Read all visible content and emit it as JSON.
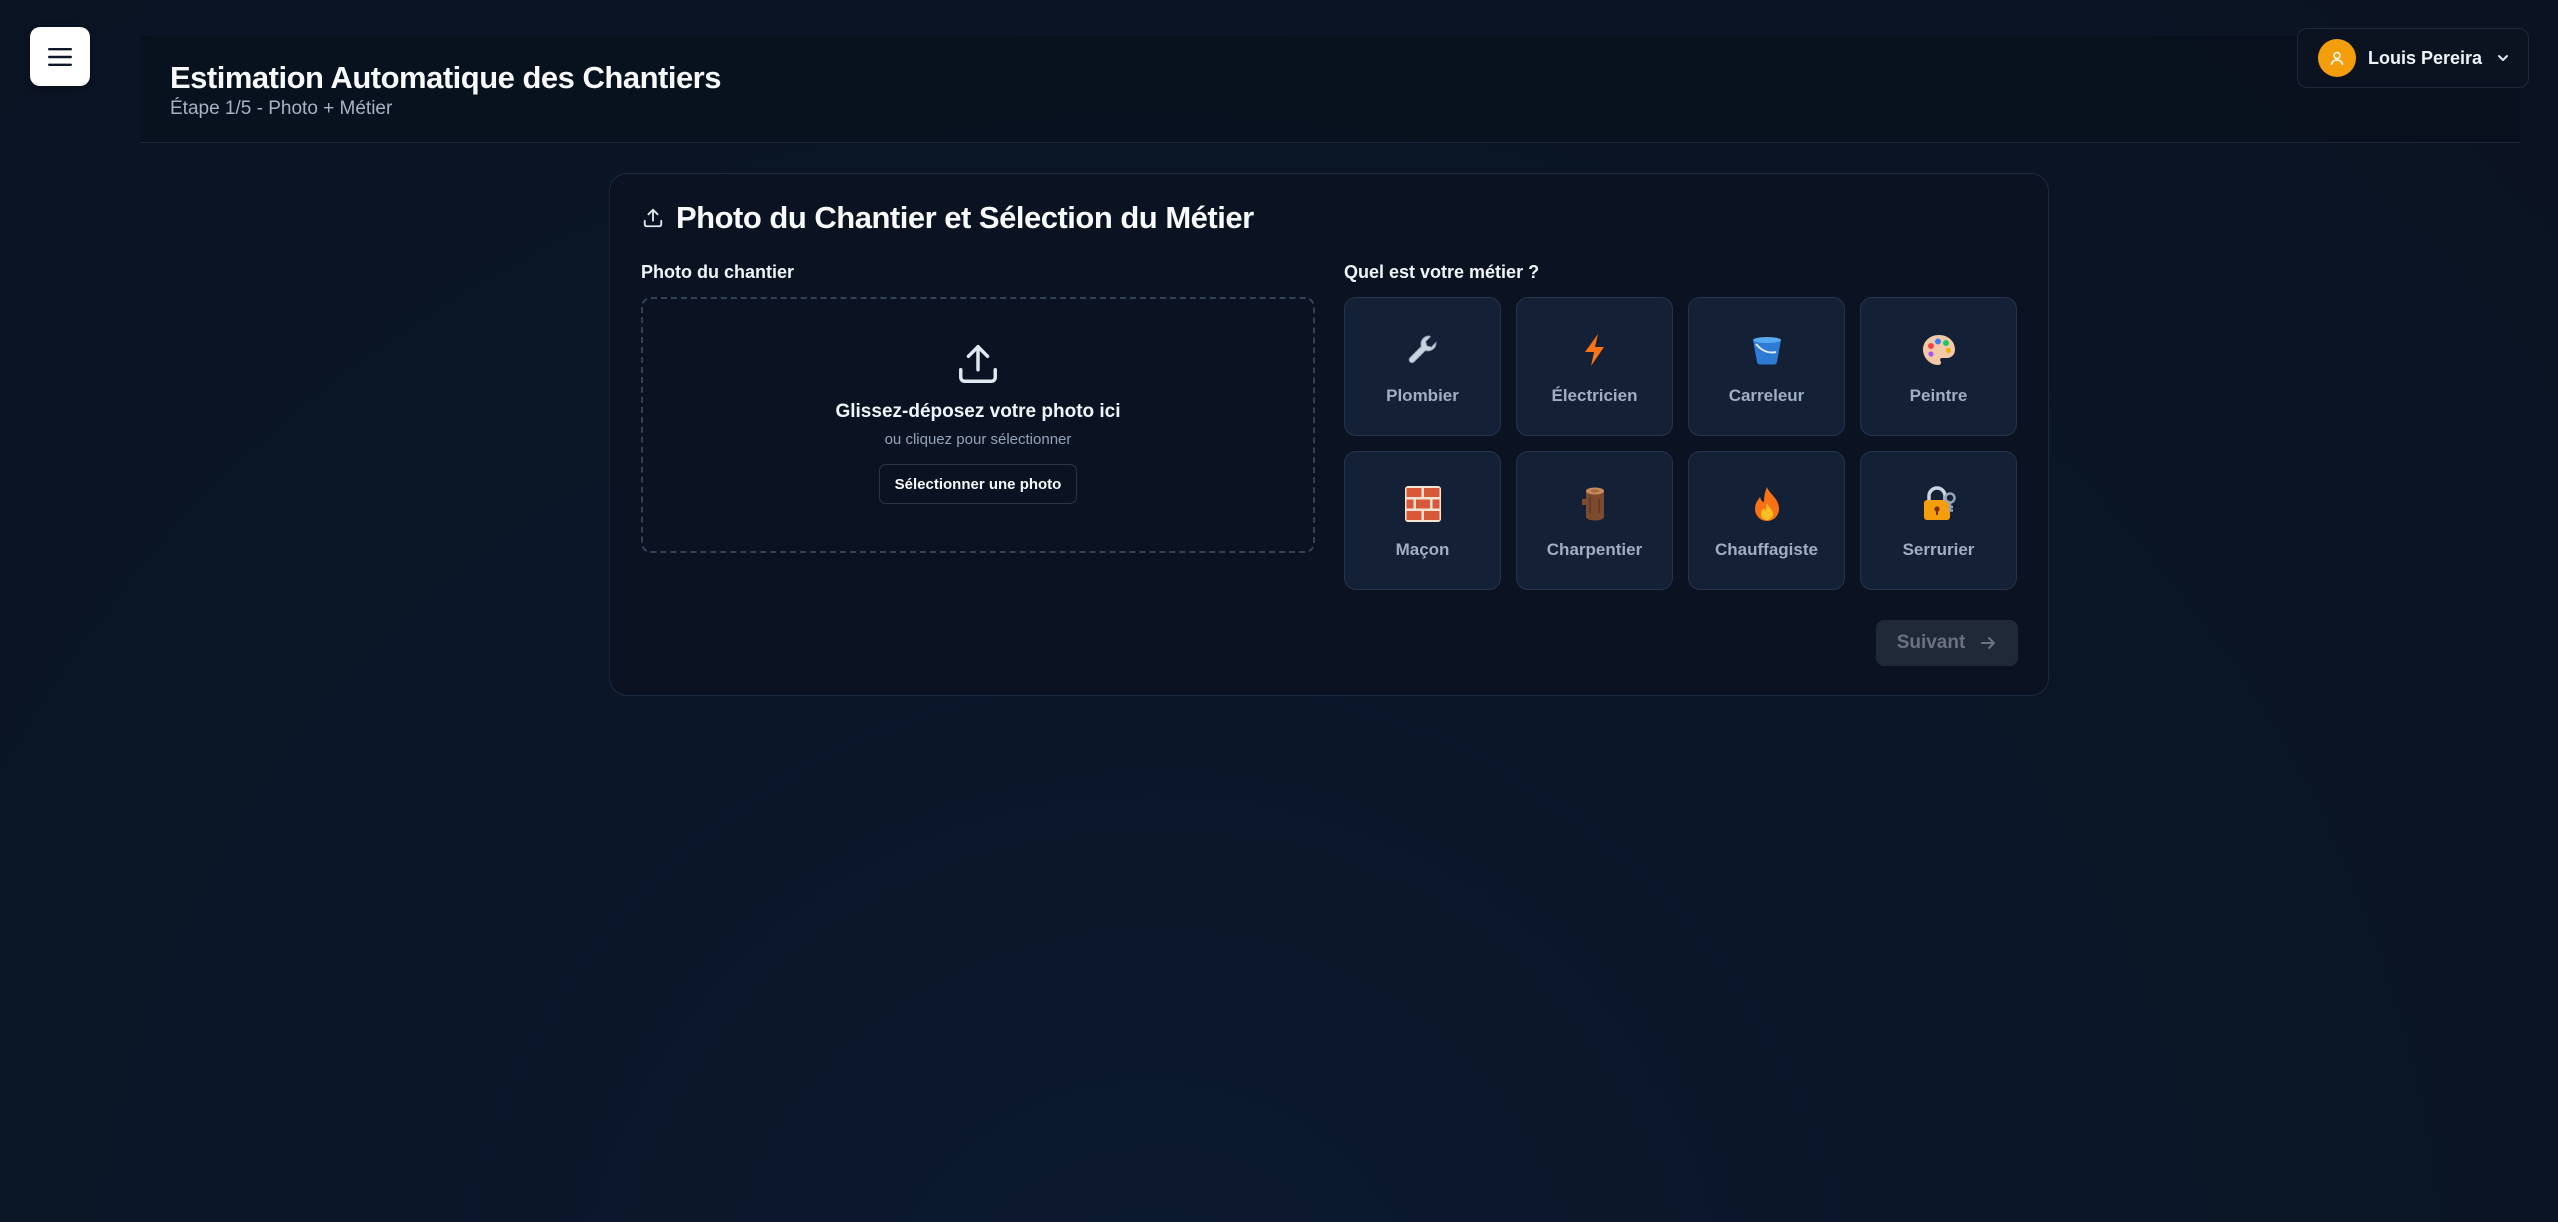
{
  "header": {
    "title": "Estimation Automatique des Chantiers",
    "subtitle": "Étape 1/5 - Photo + Métier"
  },
  "user": {
    "name": "Louis Pereira",
    "avatar_color": "#f59e0b",
    "avatar_icon": "user-icon"
  },
  "card": {
    "title": "Photo du Chantier et Sélection du Métier",
    "title_icon": "upload-icon",
    "photo_section": {
      "label": "Photo du chantier",
      "drop_title": "Glissez-déposez votre photo ici",
      "drop_hint": "ou cliquez pour sélectionner",
      "select_button": "Sélectionner une photo"
    },
    "trade_section": {
      "label": "Quel est votre métier ?",
      "trades": [
        {
          "label": "Plombier",
          "icon": "wrench-icon"
        },
        {
          "label": "Électricien",
          "icon": "lightning-icon"
        },
        {
          "label": "Carreleur",
          "icon": "tile-bucket-icon"
        },
        {
          "label": "Peintre",
          "icon": "palette-icon"
        },
        {
          "label": "Maçon",
          "icon": "brick-icon"
        },
        {
          "label": "Charpentier",
          "icon": "wood-log-icon"
        },
        {
          "label": "Chauffagiste",
          "icon": "flame-icon"
        },
        {
          "label": "Serrurier",
          "icon": "lock-key-icon"
        }
      ]
    },
    "next_button": "Suivant"
  },
  "colors": {
    "background": "#0a1628",
    "card_background": "#0b1322",
    "trade_tile": "#132036",
    "accent_avatar": "#f59e0b",
    "disabled_button": "#1f2937"
  }
}
